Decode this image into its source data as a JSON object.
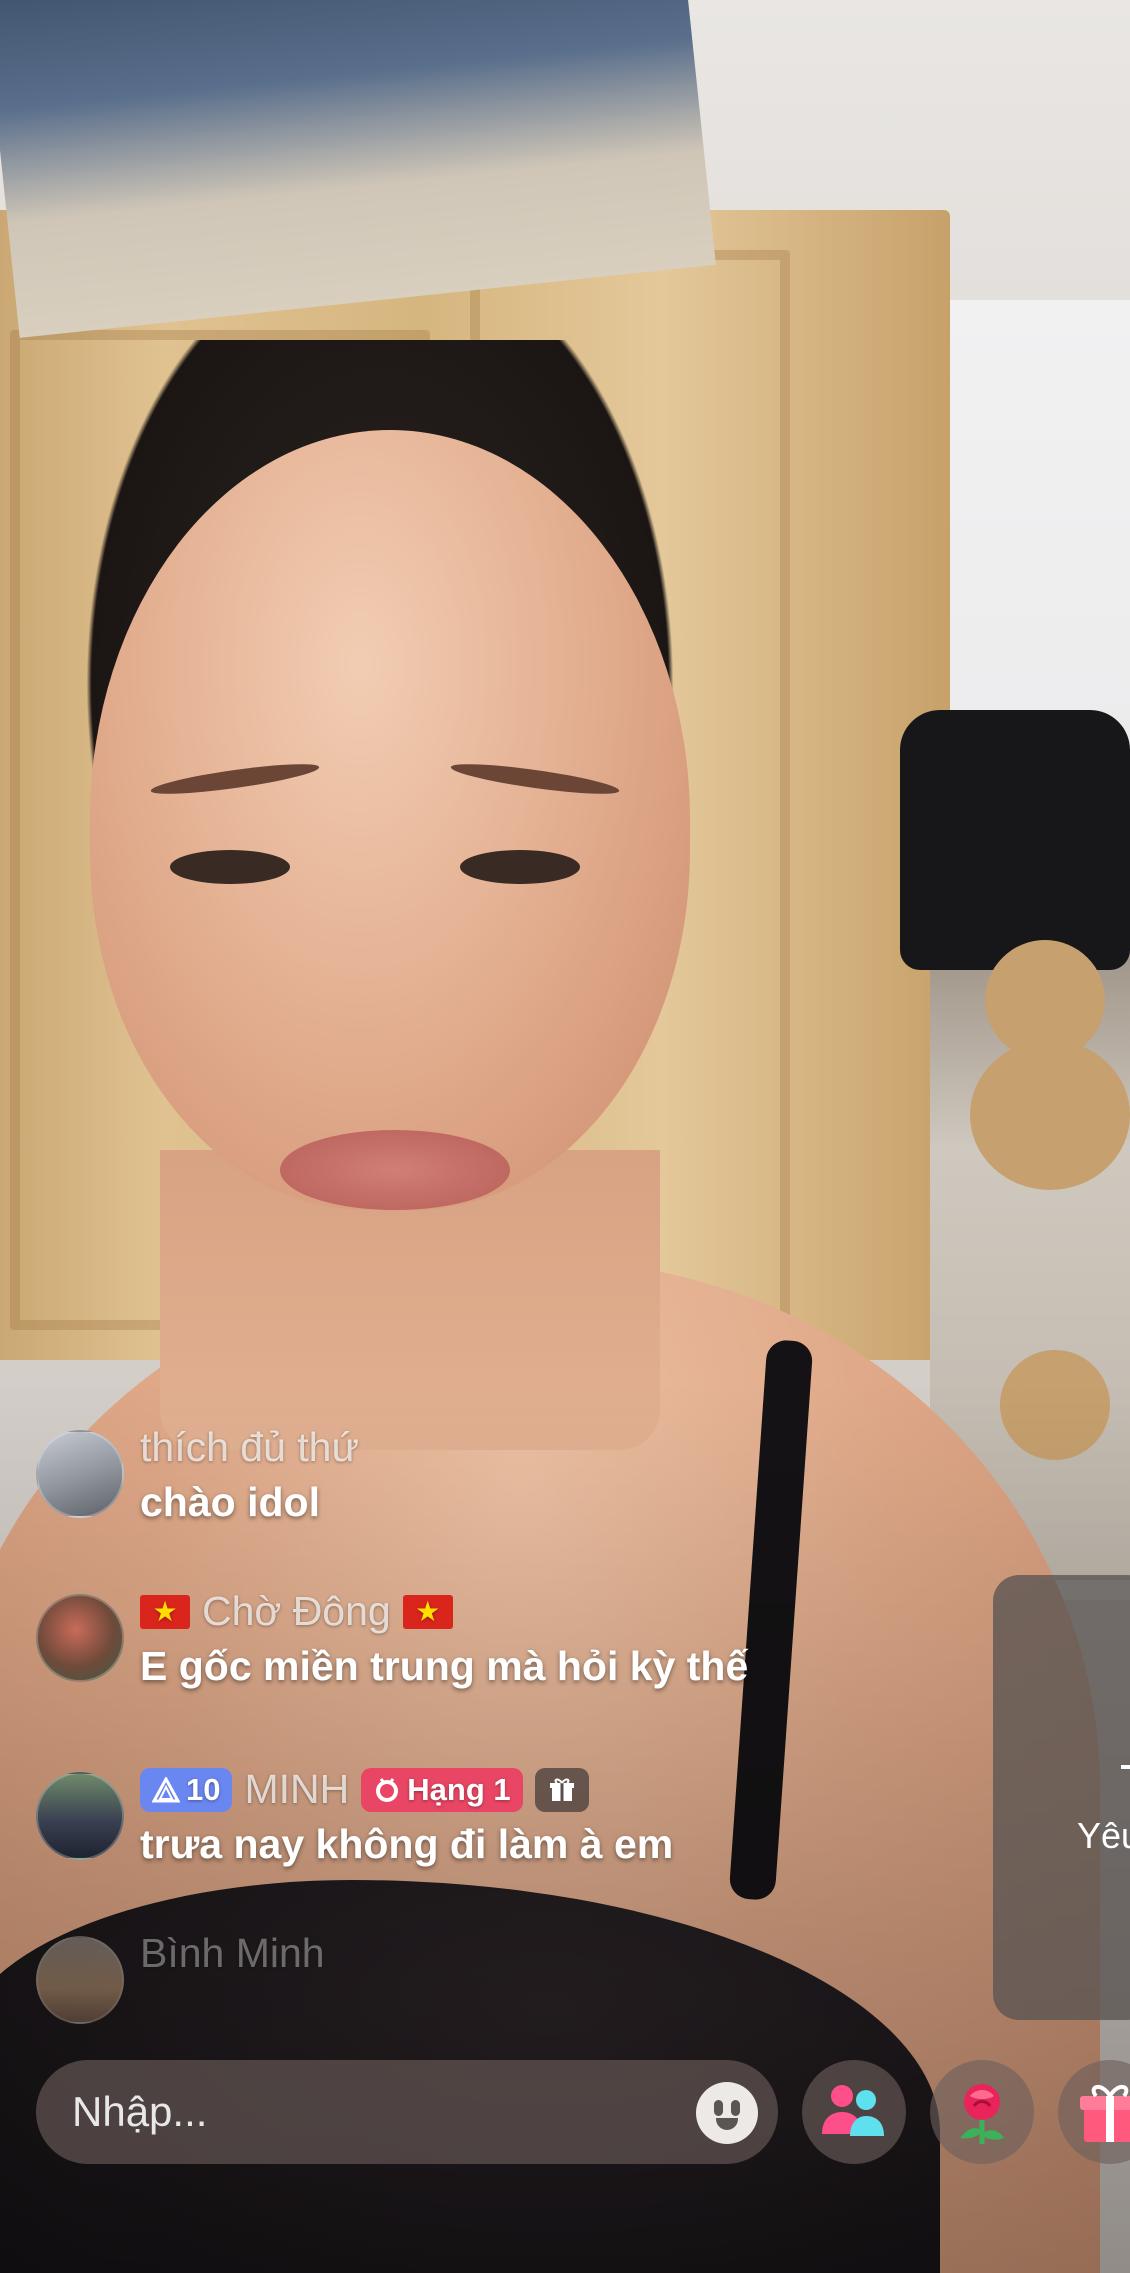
{
  "stream": {
    "background_description_colors": {
      "accent_pink": "#e84664",
      "level_blue": "#6a86f0"
    }
  },
  "comments": [
    {
      "user": "thích đủ thứ",
      "text": "chào idol"
    },
    {
      "user": "Chờ Đông",
      "text": "E gốc miền trung mà hỏi kỳ thế",
      "flags": [
        "★",
        "★"
      ]
    },
    {
      "user": "MINH",
      "level": "10",
      "rank": "Hạng 1",
      "text": "trưa nay không đi làm à em"
    },
    {
      "user": "Bình Minh",
      "text": ""
    }
  ],
  "side_panel": {
    "label": "Yêu"
  },
  "input": {
    "placeholder": "Nhập..."
  },
  "icons": {
    "emoji": "emoji-icon",
    "multi_guest": "people-icon",
    "rose": "rose-gift-icon",
    "gift": "gift-icon",
    "level": "triangle-icon",
    "rank": "medal-icon",
    "gift_badge": "gift-icon"
  }
}
